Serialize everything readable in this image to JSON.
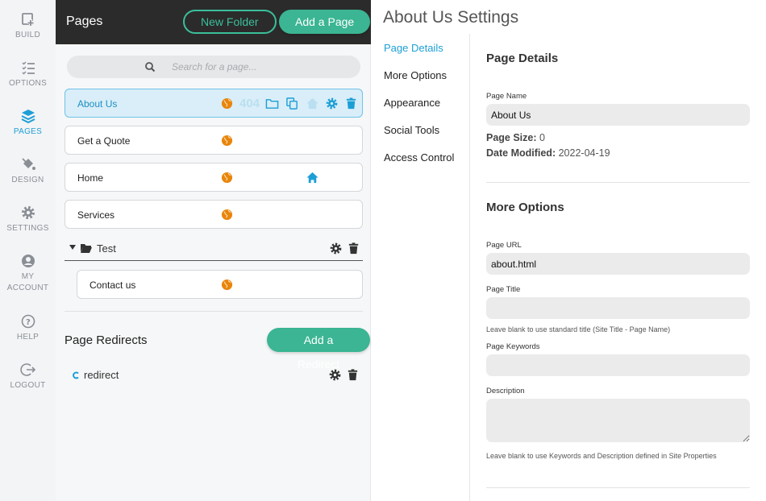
{
  "rail": [
    {
      "label": "BUILD",
      "icon": "build-icon"
    },
    {
      "label": "OPTIONS",
      "icon": "options-list-icon"
    },
    {
      "label": "PAGES",
      "icon": "pages-layers-icon"
    },
    {
      "label": "DESIGN",
      "icon": "paint-bucket-icon"
    },
    {
      "label": "SETTINGS",
      "icon": "gear-icon"
    },
    {
      "label": "MY",
      "label2": "ACCOUNT",
      "icon": "user-circle-icon"
    },
    {
      "label": "HELP",
      "icon": "help-circle-icon"
    },
    {
      "label": "LOGOUT",
      "icon": "logout-icon"
    }
  ],
  "pages_panel": {
    "title": "Pages",
    "new_folder": "New Folder",
    "add_page": "Add a Page",
    "search_placeholder": "Search for a page...",
    "pages": [
      {
        "name": "About Us"
      },
      {
        "name": "Get a Quote"
      },
      {
        "name": "Home"
      },
      {
        "name": "Services"
      }
    ],
    "badge_404": "404",
    "folder": {
      "name": "Test",
      "pages": [
        {
          "name": "Contact us"
        }
      ]
    },
    "redirects_title": "Page Redirects",
    "add_redirect": "Add a Redirect",
    "redirects": [
      {
        "name": "redirect"
      }
    ]
  },
  "settings": {
    "title": "About Us Settings",
    "nav": [
      "Page Details",
      "More Options",
      "Appearance",
      "Social Tools",
      "Access Control"
    ],
    "page_details": {
      "heading": "Page Details",
      "page_name_label": "Page Name",
      "page_name_value": "About Us",
      "page_size_label": "Page Size:",
      "page_size_value": "0",
      "date_modified_label": "Date Modified:",
      "date_modified_value": "2022-04-19"
    },
    "more_options": {
      "heading": "More Options",
      "page_url_label": "Page URL",
      "page_url_value": "about.html",
      "page_title_label": "Page Title",
      "page_title_value": "",
      "page_title_hint": "Leave blank to use standard title (Site Title - Page Name)",
      "keywords_label": "Page Keywords",
      "keywords_value": "",
      "description_label": "Description",
      "description_value": "",
      "description_hint": "Leave blank to use Keywords and Description defined in Site Properties"
    }
  },
  "colors": {
    "accent_blue": "#1d9fd6",
    "accent_green": "#3bb593",
    "globe_orange": "#e8850c"
  }
}
